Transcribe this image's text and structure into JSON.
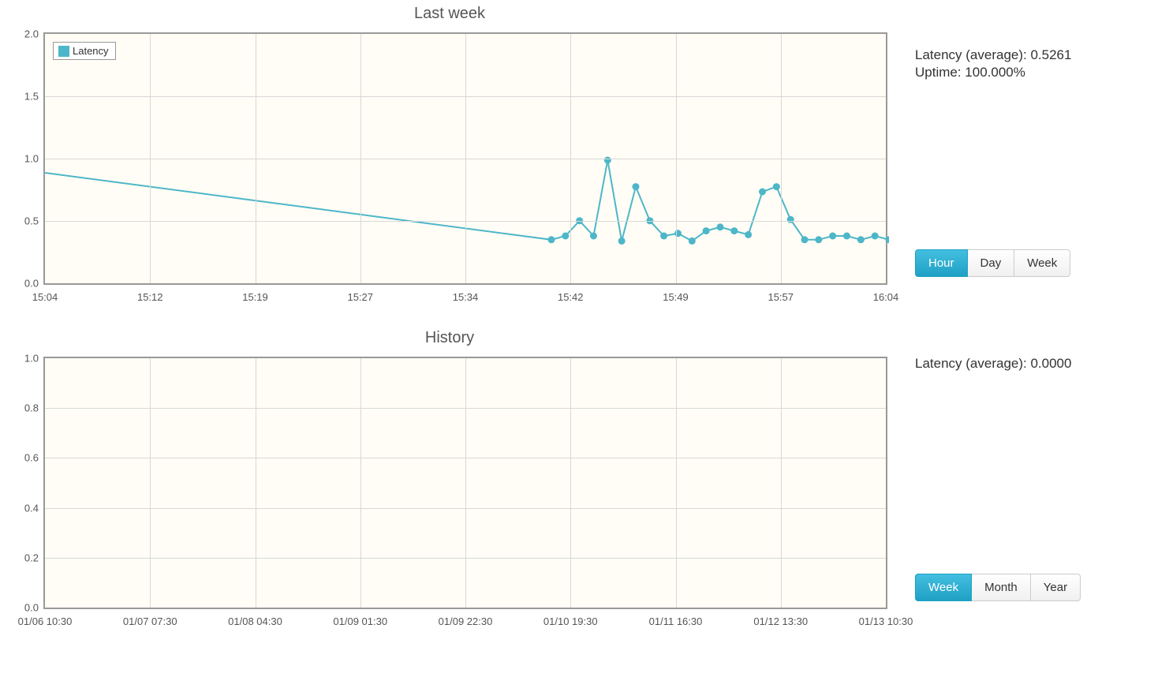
{
  "chart1": {
    "title": "Last week",
    "legend": "Latency",
    "y_ticks": [
      "0.0",
      "0.5",
      "1.0",
      "1.5",
      "2.0"
    ],
    "x_ticks": [
      "15:04",
      "15:12",
      "15:19",
      "15:27",
      "15:34",
      "15:42",
      "15:49",
      "15:57",
      "16:04"
    ],
    "stats": {
      "latency_label": "Latency (average): ",
      "latency_value": "0.5261",
      "uptime_label": "Uptime: ",
      "uptime_value": "100.000%"
    },
    "buttons": [
      "Hour",
      "Day",
      "Week"
    ],
    "active_button": 0
  },
  "chart2": {
    "title": "History",
    "y_ticks": [
      "0.0",
      "0.2",
      "0.4",
      "0.6",
      "0.8",
      "1.0"
    ],
    "x_ticks": [
      "01/06 10:30",
      "01/07 07:30",
      "01/08 04:30",
      "01/09 01:30",
      "01/09 22:30",
      "01/10 19:30",
      "01/11 16:30",
      "01/12 13:30",
      "01/13 10:30"
    ],
    "stats": {
      "latency_label": "Latency (average): ",
      "latency_value": "0.0000"
    },
    "buttons": [
      "Week",
      "Month",
      "Year"
    ],
    "active_button": 0
  },
  "chart_data": [
    {
      "type": "line",
      "title": "Last week",
      "legend": [
        "Latency"
      ],
      "ylabel": "",
      "xlabel": "",
      "ylim": [
        0,
        2
      ],
      "xlim_minutes": [
        0,
        60
      ],
      "x_tick_labels": [
        "15:04",
        "15:12",
        "15:19",
        "15:27",
        "15:34",
        "15:42",
        "15:49",
        "15:57",
        "16:04"
      ],
      "series": [
        {
          "name": "Latency",
          "points": [
            {
              "x_min": 0,
              "y": 0.9,
              "marker": false
            },
            {
              "x_min": 36,
              "y": 0.37,
              "marker": true
            },
            {
              "x_min": 37,
              "y": 0.4,
              "marker": true
            },
            {
              "x_min": 38,
              "y": 0.52,
              "marker": true
            },
            {
              "x_min": 39,
              "y": 0.4,
              "marker": true
            },
            {
              "x_min": 40,
              "y": 1.0,
              "marker": true
            },
            {
              "x_min": 41,
              "y": 0.36,
              "marker": true
            },
            {
              "x_min": 42,
              "y": 0.79,
              "marker": true
            },
            {
              "x_min": 43,
              "y": 0.52,
              "marker": true
            },
            {
              "x_min": 44,
              "y": 0.4,
              "marker": true
            },
            {
              "x_min": 45,
              "y": 0.42,
              "marker": true
            },
            {
              "x_min": 46,
              "y": 0.36,
              "marker": true
            },
            {
              "x_min": 47,
              "y": 0.44,
              "marker": true
            },
            {
              "x_min": 48,
              "y": 0.47,
              "marker": true
            },
            {
              "x_min": 49,
              "y": 0.44,
              "marker": true
            },
            {
              "x_min": 50,
              "y": 0.41,
              "marker": true
            },
            {
              "x_min": 51,
              "y": 0.75,
              "marker": true
            },
            {
              "x_min": 52,
              "y": 0.79,
              "marker": true
            },
            {
              "x_min": 53,
              "y": 0.53,
              "marker": true
            },
            {
              "x_min": 54,
              "y": 0.37,
              "marker": true
            },
            {
              "x_min": 55,
              "y": 0.37,
              "marker": true
            },
            {
              "x_min": 56,
              "y": 0.4,
              "marker": true
            },
            {
              "x_min": 57,
              "y": 0.4,
              "marker": true
            },
            {
              "x_min": 58,
              "y": 0.37,
              "marker": true
            },
            {
              "x_min": 59,
              "y": 0.4,
              "marker": true
            },
            {
              "x_min": 60,
              "y": 0.37,
              "marker": true
            }
          ]
        }
      ]
    },
    {
      "type": "line",
      "title": "History",
      "legend": [],
      "ylabel": "",
      "xlabel": "",
      "ylim": [
        0,
        1
      ],
      "x_tick_labels": [
        "01/06 10:30",
        "01/07 07:30",
        "01/08 04:30",
        "01/09 01:30",
        "01/09 22:30",
        "01/10 19:30",
        "01/11 16:30",
        "01/12 13:30",
        "01/13 10:30"
      ],
      "series": []
    }
  ]
}
